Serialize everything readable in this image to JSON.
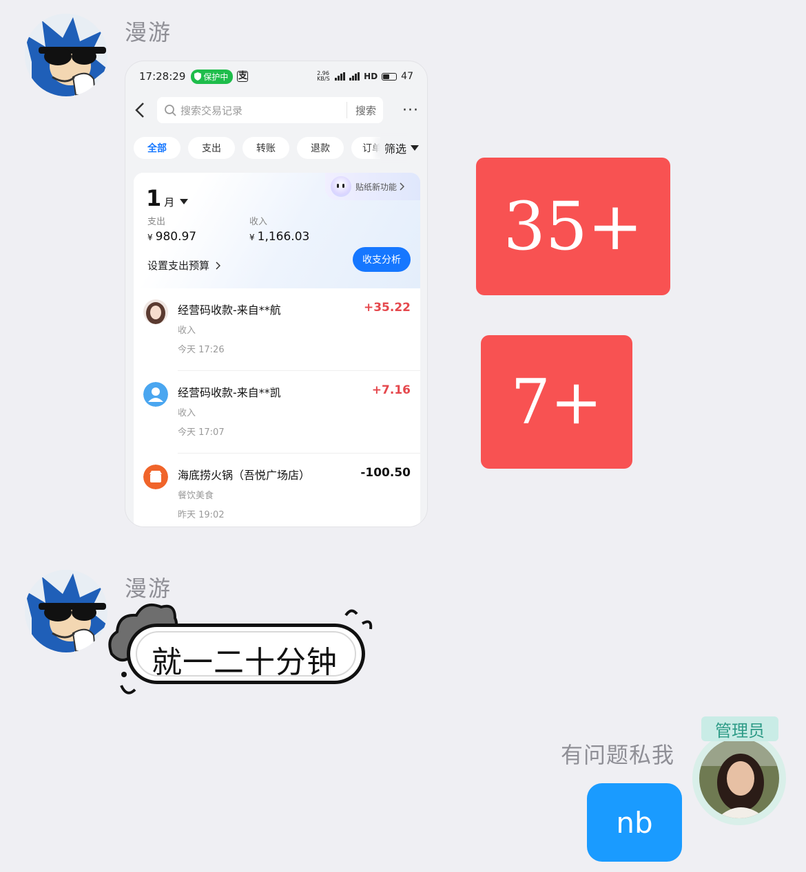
{
  "messages": {
    "first": {
      "sender": "漫游",
      "screenshot": {
        "status_bar": {
          "time": "17:28:29",
          "protect_label": "保护中",
          "pay_glyph": "支",
          "net_speed": "2.96 KB/S",
          "hd_label": "HD",
          "battery": "47"
        },
        "search": {
          "placeholder": "搜索交易记录",
          "button": "搜索",
          "more": "···"
        },
        "chips": [
          "全部",
          "支出",
          "转账",
          "退款",
          "订单"
        ],
        "filter_label": "筛选",
        "summary": {
          "month_num": "1",
          "month_unit": "月",
          "sticker_label": "贴纸新功能",
          "expense_label": "支出",
          "expense_value": "980.97",
          "income_label": "收入",
          "income_value": "1,166.03",
          "currency": "¥",
          "budget_label": "设置支出预算",
          "analysis_button": "收支分析"
        },
        "transactions": [
          {
            "title": "经营码收款-来自**航",
            "category": "收入",
            "time": "今天 17:26",
            "amount": "+35.22",
            "type": "income"
          },
          {
            "title": "经营码收款-来自**凯",
            "category": "收入",
            "time": "今天 17:07",
            "amount": "+7.16",
            "type": "income"
          },
          {
            "title": "海底捞火锅（吾悦广场店）",
            "category": "餐饮美食",
            "time": "昨天 19:02",
            "amount": "-100.50",
            "type": "expense"
          }
        ]
      }
    },
    "stickers": {
      "badge_1": "35+",
      "badge_2": "7+",
      "badge_color": "#f85252"
    },
    "second": {
      "sender": "漫游",
      "bubble_text": "就一二十分钟"
    },
    "admin": {
      "tag": "管理员",
      "name": "有问题私我",
      "message": "nb",
      "bubble_color": "#1a9bff"
    }
  }
}
